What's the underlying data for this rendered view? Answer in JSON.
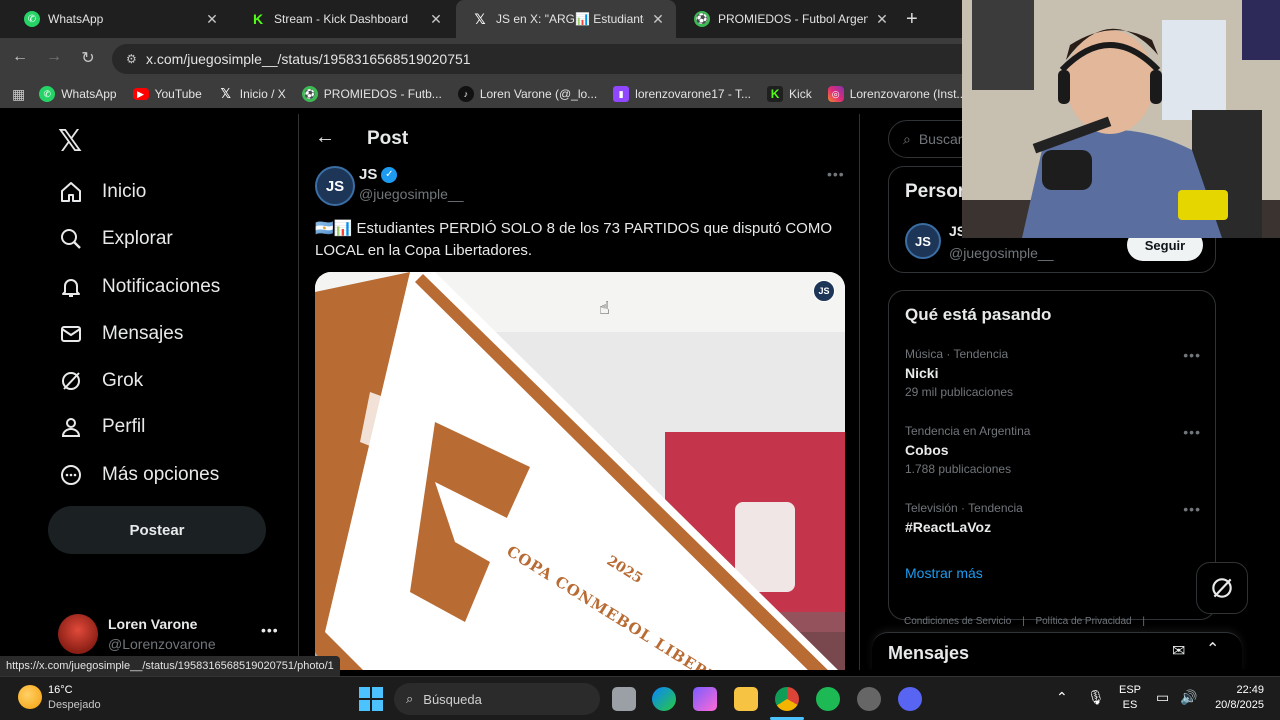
{
  "tabs": [
    {
      "title": "WhatsApp",
      "icon": "whatsapp-icon",
      "color": "#25d366"
    },
    {
      "title": "Stream - Kick Dashboard",
      "icon": "kick-icon",
      "color": "#53fc18"
    },
    {
      "title": "JS en X: \"ARG📊 Estudiantes PERD",
      "icon": "x-icon",
      "color": "#ffffff",
      "active": true
    },
    {
      "title": "PROMIEDOS - Futbol Argentino",
      "icon": "promiedos-icon",
      "color": "#3cba54"
    }
  ],
  "address": "x.com/juegosimple__/status/1958316568519020751",
  "bookmarks": [
    {
      "label": "WhatsApp",
      "icon": "whatsapp-icon",
      "color": "#25d366"
    },
    {
      "label": "YouTube",
      "icon": "youtube-icon",
      "color": "#ff0000"
    },
    {
      "label": "Inicio / X",
      "icon": "x-icon",
      "color": "#000000"
    },
    {
      "label": "PROMIEDOS - Futb...",
      "icon": "promiedos-icon",
      "color": "#3cba54"
    },
    {
      "label": "Loren Varone (@_lo...",
      "icon": "tiktok-icon",
      "color": "#111111"
    },
    {
      "label": "lorenzovarone17 - T...",
      "icon": "twitch-icon",
      "color": "#9146ff"
    },
    {
      "label": "Kick",
      "icon": "kick-icon",
      "color": "#53fc18"
    },
    {
      "label": "Lorenzovarone (Inst...",
      "icon": "instagram-icon",
      "color": "#e1306c"
    }
  ],
  "nav": {
    "items": [
      {
        "label": "Inicio",
        "icon": "home-icon"
      },
      {
        "label": "Explorar",
        "icon": "search-icon"
      },
      {
        "label": "Notificaciones",
        "icon": "bell-icon"
      },
      {
        "label": "Mensajes",
        "icon": "mail-icon"
      },
      {
        "label": "Grok",
        "icon": "grok-icon"
      },
      {
        "label": "Perfil",
        "icon": "person-icon"
      },
      {
        "label": "Más opciones",
        "icon": "more-circle-icon"
      }
    ],
    "post_label": "Postear"
  },
  "account": {
    "name": "Loren Varone",
    "handle": "@Lorenzovarone"
  },
  "post": {
    "header": "Post",
    "author_name": "JS",
    "author_handle": "@juegosimple__",
    "avatar_text": "JS",
    "text": "🇦🇷📊 Estudiantes PERDIÓ SOLO 8 de los 73 PARTIDOS que disputó COMO LOCAL en la Copa Libertadores.",
    "media": {
      "pennant_text": "COPA CONMEBOL LIBERTADORES",
      "year": "2025",
      "watermark": "JS"
    }
  },
  "right": {
    "search_placeholder": "Buscar",
    "relevant_title": "Person",
    "relevant_name": "JS",
    "relevant_handle": "@juegosimple__",
    "follow_label": "Seguir",
    "trends_title": "Qué está pasando",
    "trends": [
      {
        "meta": "Música · Tendencia",
        "name": "Nicki",
        "count": "29 mil publicaciones"
      },
      {
        "meta": "Tendencia en Argentina",
        "name": "Cobos",
        "count": "1.788 publicaciones"
      },
      {
        "meta": "Televisión · Tendencia",
        "name": "#ReactLaVoz",
        "count": ""
      }
    ],
    "show_more": "Mostrar más",
    "footer_links": [
      "Condiciones de Servicio",
      "Política de Privacidad"
    ],
    "messages_title": "Mensajes"
  },
  "status_url": "https://x.com/juegosimple__/status/1958316568519020751/photo/1",
  "taskbar": {
    "weather_temp": "16°C",
    "weather_desc": "Despejado",
    "search_label": "Búsqueda",
    "lang_top": "ESP",
    "lang_bottom": "ES",
    "time": "22:49",
    "date": "20/8/2025"
  }
}
